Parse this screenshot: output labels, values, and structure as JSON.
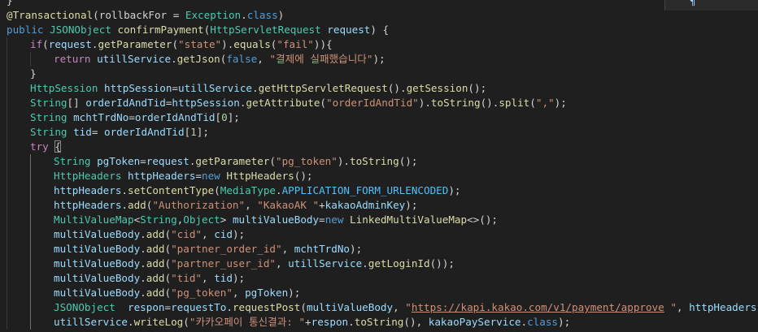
{
  "editor": {
    "corner_widget_text": "¶",
    "lines": [
      {
        "indent": 0,
        "tokens": [
          [
            "punct",
            "}"
          ]
        ]
      },
      {
        "indent": 0,
        "tokens": [
          [
            "annotation",
            "@Transactional"
          ],
          [
            "punct",
            "(rollbackFor = "
          ],
          [
            "type",
            "Exception"
          ],
          [
            "punct",
            "."
          ],
          [
            "keyword",
            "class"
          ],
          [
            "punct",
            ")"
          ]
        ]
      },
      {
        "indent": 0,
        "tokens": [
          [
            "keyword",
            "public "
          ],
          [
            "type",
            "JSONObject "
          ],
          [
            "method",
            "confirmPayment"
          ],
          [
            "punct",
            "("
          ],
          [
            "type",
            "HttpServletRequest "
          ],
          [
            "param",
            "request"
          ],
          [
            "punct",
            ") {"
          ]
        ]
      },
      {
        "indent": 1,
        "tokens": [
          [
            "control",
            "if"
          ],
          [
            "punct",
            "("
          ],
          [
            "variable",
            "request"
          ],
          [
            "punct",
            "."
          ],
          [
            "method",
            "getParameter"
          ],
          [
            "punct",
            "("
          ],
          [
            "string",
            "\"state\""
          ],
          [
            "punct",
            ")."
          ],
          [
            "method",
            "equals"
          ],
          [
            "punct",
            "("
          ],
          [
            "string",
            "\"fail\""
          ],
          [
            "punct",
            "))"
          ],
          [
            "punct",
            "{"
          ]
        ]
      },
      {
        "indent": 2,
        "tokens": [
          [
            "control",
            "return "
          ],
          [
            "variable",
            "utillService"
          ],
          [
            "punct",
            "."
          ],
          [
            "method",
            "getJson"
          ],
          [
            "punct",
            "("
          ],
          [
            "keyword",
            "false"
          ],
          [
            "punct",
            ", "
          ],
          [
            "string",
            "\"결제에 실패했습니다\""
          ],
          [
            "punct",
            ");"
          ]
        ]
      },
      {
        "indent": 1,
        "tokens": [
          [
            "punct",
            "}"
          ]
        ]
      },
      {
        "indent": 1,
        "tokens": [
          [
            "type",
            "HttpSession "
          ],
          [
            "variable",
            "httpSession"
          ],
          [
            "punct",
            "="
          ],
          [
            "variable",
            "utillService"
          ],
          [
            "punct",
            "."
          ],
          [
            "method",
            "getHttpServletRequest"
          ],
          [
            "punct",
            "()."
          ],
          [
            "method",
            "getSession"
          ],
          [
            "punct",
            "();"
          ]
        ]
      },
      {
        "indent": 1,
        "tokens": [
          [
            "type",
            "String"
          ],
          [
            "punct",
            "[] "
          ],
          [
            "variable",
            "orderIdAndTid"
          ],
          [
            "punct",
            "="
          ],
          [
            "variable",
            "httpSession"
          ],
          [
            "punct",
            "."
          ],
          [
            "method",
            "getAttribute"
          ],
          [
            "punct",
            "("
          ],
          [
            "string",
            "\"orderIdAndTid\""
          ],
          [
            "punct",
            ")."
          ],
          [
            "method",
            "toString"
          ],
          [
            "punct",
            "()."
          ],
          [
            "method",
            "split"
          ],
          [
            "punct",
            "("
          ],
          [
            "string",
            "\",\""
          ],
          [
            "punct",
            ");"
          ]
        ]
      },
      {
        "indent": 1,
        "tokens": [
          [
            "type",
            "String "
          ],
          [
            "variable",
            "mchtTrdNo"
          ],
          [
            "punct",
            "="
          ],
          [
            "variable",
            "orderIdAndTid"
          ],
          [
            "punct",
            "["
          ],
          [
            "number",
            "0"
          ],
          [
            "punct",
            "];"
          ]
        ]
      },
      {
        "indent": 1,
        "tokens": [
          [
            "type",
            "String "
          ],
          [
            "variable",
            "tid"
          ],
          [
            "punct",
            "= "
          ],
          [
            "variable",
            "orderIdAndTid"
          ],
          [
            "punct",
            "["
          ],
          [
            "number",
            "1"
          ],
          [
            "punct",
            "];"
          ]
        ]
      },
      {
        "indent": 1,
        "tokens": [
          [
            "control",
            "try "
          ],
          [
            "bracket",
            "{"
          ]
        ]
      },
      {
        "indent": 2,
        "tokens": [
          [
            "type",
            "String "
          ],
          [
            "variable",
            "pgToken"
          ],
          [
            "punct",
            "="
          ],
          [
            "variable",
            "request"
          ],
          [
            "punct",
            "."
          ],
          [
            "method",
            "getParameter"
          ],
          [
            "punct",
            "("
          ],
          [
            "string",
            "\"pg_token\""
          ],
          [
            "punct",
            ")."
          ],
          [
            "method",
            "toString"
          ],
          [
            "punct",
            "();"
          ]
        ]
      },
      {
        "indent": 2,
        "tokens": [
          [
            "type",
            "HttpHeaders "
          ],
          [
            "variable",
            "httpHeaders"
          ],
          [
            "punct",
            "="
          ],
          [
            "keyword",
            "new "
          ],
          [
            "method",
            "HttpHeaders"
          ],
          [
            "punct",
            "();"
          ]
        ]
      },
      {
        "indent": 2,
        "tokens": [
          [
            "variable",
            "httpHeaders"
          ],
          [
            "punct",
            "."
          ],
          [
            "method",
            "setContentType"
          ],
          [
            "punct",
            "("
          ],
          [
            "type",
            "MediaType"
          ],
          [
            "punct",
            "."
          ],
          [
            "constant",
            "APPLICATION_FORM_URLENCODED"
          ],
          [
            "punct",
            ");"
          ]
        ]
      },
      {
        "indent": 2,
        "tokens": [
          [
            "variable",
            "httpHeaders"
          ],
          [
            "punct",
            "."
          ],
          [
            "method",
            "add"
          ],
          [
            "punct",
            "("
          ],
          [
            "string",
            "\"Authorization\""
          ],
          [
            "punct",
            ", "
          ],
          [
            "string",
            "\"KakaoAK \""
          ],
          [
            "punct",
            "+"
          ],
          [
            "variable",
            "kakaoAdminKey"
          ],
          [
            "punct",
            ");"
          ]
        ]
      },
      {
        "indent": 2,
        "tokens": [
          [
            "type",
            "MultiValueMap"
          ],
          [
            "punct",
            "<"
          ],
          [
            "type",
            "String"
          ],
          [
            "punct",
            ","
          ],
          [
            "type",
            "Object"
          ],
          [
            "punct",
            "> "
          ],
          [
            "variable",
            "multiValueBody"
          ],
          [
            "punct",
            "="
          ],
          [
            "keyword",
            "new "
          ],
          [
            "method",
            "LinkedMultiValueMap"
          ],
          [
            "punct",
            "<>();"
          ]
        ]
      },
      {
        "indent": 2,
        "tokens": [
          [
            "variable",
            "multiValueBody"
          ],
          [
            "punct",
            "."
          ],
          [
            "method",
            "add"
          ],
          [
            "punct",
            "("
          ],
          [
            "string",
            "\"cid\""
          ],
          [
            "punct",
            ", "
          ],
          [
            "variable",
            "cid"
          ],
          [
            "punct",
            ");"
          ]
        ]
      },
      {
        "indent": 2,
        "tokens": [
          [
            "variable",
            "multiValueBody"
          ],
          [
            "punct",
            "."
          ],
          [
            "method",
            "add"
          ],
          [
            "punct",
            "("
          ],
          [
            "string",
            "\"partner_order_id\""
          ],
          [
            "punct",
            ", "
          ],
          [
            "variable",
            "mchtTrdNo"
          ],
          [
            "punct",
            ");"
          ]
        ]
      },
      {
        "indent": 2,
        "tokens": [
          [
            "variable",
            "multiValueBody"
          ],
          [
            "punct",
            "."
          ],
          [
            "method",
            "add"
          ],
          [
            "punct",
            "("
          ],
          [
            "string",
            "\"partner_user_id\""
          ],
          [
            "punct",
            ", "
          ],
          [
            "variable",
            "utillService"
          ],
          [
            "punct",
            "."
          ],
          [
            "method",
            "getLoginId"
          ],
          [
            "punct",
            "());"
          ]
        ]
      },
      {
        "indent": 2,
        "tokens": [
          [
            "variable",
            "multiValueBody"
          ],
          [
            "punct",
            "."
          ],
          [
            "method",
            "add"
          ],
          [
            "punct",
            "("
          ],
          [
            "string",
            "\"tid\""
          ],
          [
            "punct",
            ", "
          ],
          [
            "variable",
            "tid"
          ],
          [
            "punct",
            ");"
          ]
        ]
      },
      {
        "indent": 2,
        "tokens": [
          [
            "variable",
            "multiValueBody"
          ],
          [
            "punct",
            "."
          ],
          [
            "method",
            "add"
          ],
          [
            "punct",
            "("
          ],
          [
            "string",
            "\"pg_token\""
          ],
          [
            "punct",
            ", "
          ],
          [
            "variable",
            "pgToken"
          ],
          [
            "punct",
            ");"
          ]
        ]
      },
      {
        "indent": 2,
        "tokens": [
          [
            "type",
            "JSONObject  "
          ],
          [
            "variable",
            "respon"
          ],
          [
            "punct",
            "="
          ],
          [
            "variable",
            "requestTo"
          ],
          [
            "punct",
            "."
          ],
          [
            "method",
            "requestPost"
          ],
          [
            "punct",
            "("
          ],
          [
            "variable",
            "multiValueBody"
          ],
          [
            "punct",
            ", "
          ],
          [
            "string",
            "\""
          ],
          [
            "link",
            "https://kapi.kakao.com/v1/payment/approve"
          ],
          [
            "string",
            " \""
          ],
          [
            "punct",
            ", "
          ],
          [
            "variable",
            "httpHeaders"
          ],
          [
            "punct",
            ");"
          ]
        ]
      },
      {
        "indent": 2,
        "tokens": [
          [
            "variable",
            "utillService"
          ],
          [
            "punct",
            "."
          ],
          [
            "method",
            "writeLog"
          ],
          [
            "punct",
            "("
          ],
          [
            "string",
            "\"카카오페이 통신결과: \""
          ],
          [
            "punct",
            "+"
          ],
          [
            "variable",
            "respon"
          ],
          [
            "punct",
            "."
          ],
          [
            "method",
            "toString"
          ],
          [
            "punct",
            "(), "
          ],
          [
            "variable",
            "kakaoPayService"
          ],
          [
            "punct",
            "."
          ],
          [
            "keyword",
            "class"
          ],
          [
            "punct",
            ");"
          ]
        ]
      }
    ]
  }
}
